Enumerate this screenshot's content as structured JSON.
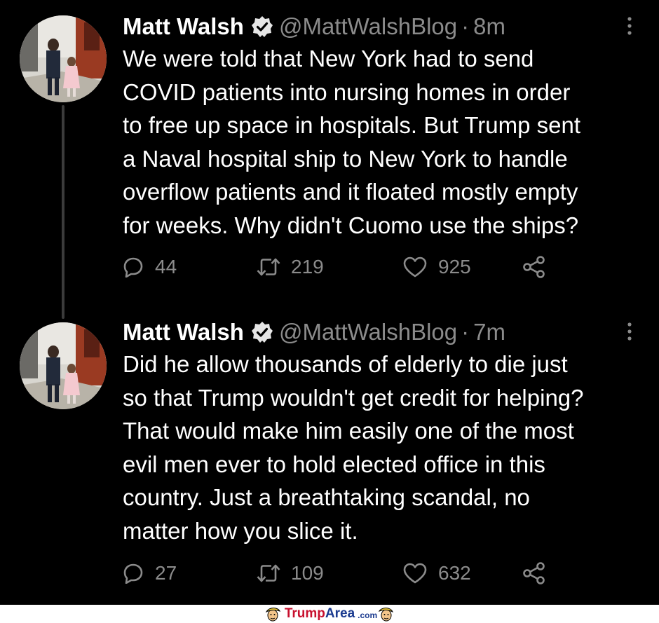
{
  "tweets": [
    {
      "name": "Matt Walsh",
      "handle": "@MattWalshBlog",
      "separator": "·",
      "time": "8m",
      "text": "We were told that New York had to send\nCOVID patients into nursing homes in order\nto free up space in hospitals. But Trump sent\na Naval hospital ship to New York to handle\noverflow patients and it floated mostly empty\nfor weeks. Why didn't Cuomo use the ships?",
      "replies": "44",
      "retweets": "219",
      "likes": "925"
    },
    {
      "name": "Matt Walsh",
      "handle": "@MattWalshBlog",
      "separator": "·",
      "time": "7m",
      "text": "Did he allow thousands of elderly to die just\nso that Trump wouldn't get credit for helping?\nThat would make him easily one of the most\nevil men ever to hold elected office in this\ncountry. Just a breathtaking scandal, no\nmatter how you slice it.",
      "replies": "27",
      "retweets": "109",
      "likes": "632"
    }
  ],
  "footer": {
    "brand_part1": "Trump",
    "brand_part2": "Area",
    "tld": ".com"
  },
  "colors": {
    "background": "#000000",
    "text": "#ffffff",
    "secondary": "#8b8b8b",
    "thread_line": "#3b3b3b"
  }
}
